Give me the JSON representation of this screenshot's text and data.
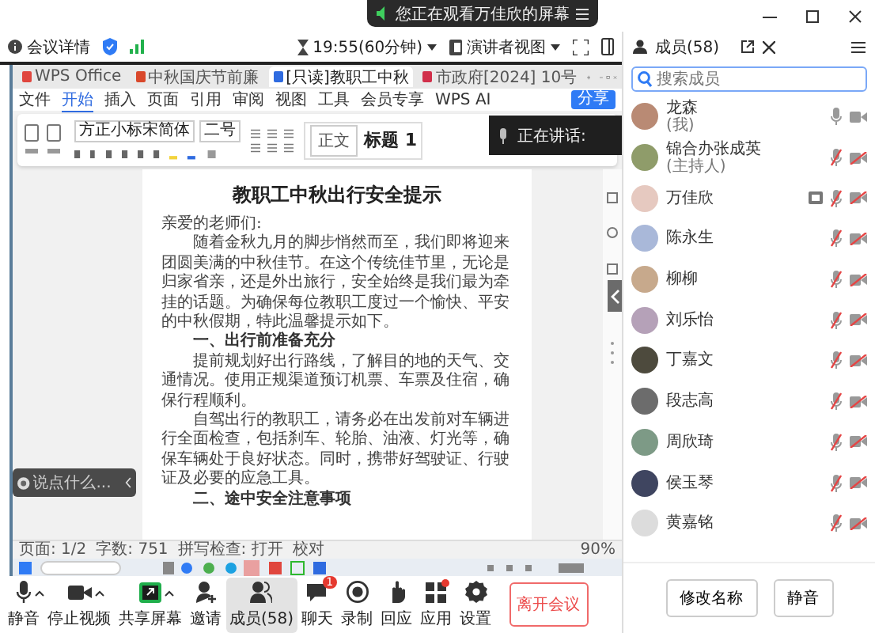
{
  "notice": {
    "text": "您正在观看万佳欣的屏幕"
  },
  "header": {
    "details": "会议详情",
    "duration": "19:55(60分钟)",
    "view": "演讲者视图"
  },
  "shared_screen": {
    "tabs": [
      {
        "label": "WPS Office",
        "kind": "home",
        "selected": false
      },
      {
        "label": "中秋国庆节前廉",
        "kind": "ppt",
        "selected": false
      },
      {
        "label": "[只读]教职工中秋",
        "kind": "doc",
        "selected": true
      },
      {
        "label": "市政府[2024] 10号",
        "kind": "pdf",
        "selected": false
      }
    ],
    "menu": [
      {
        "label": "文件",
        "selected": false
      },
      {
        "label": "开始",
        "selected": true
      },
      {
        "label": "插入",
        "selected": false
      },
      {
        "label": "页面",
        "selected": false
      },
      {
        "label": "引用",
        "selected": false
      },
      {
        "label": "审阅",
        "selected": false
      },
      {
        "label": "视图",
        "selected": false
      },
      {
        "label": "工具",
        "selected": false
      },
      {
        "label": "会员专享",
        "selected": false
      },
      {
        "label": "WPS AI",
        "selected": false
      }
    ],
    "share_button": "分享",
    "font": "方正小标宋简体",
    "font_size": "二号",
    "styles": [
      "正文",
      "标题 1"
    ],
    "document": {
      "title": "教职工中秋出行安全提示",
      "greeting": "亲爱的老师们:",
      "paragraphs": [
        {
          "kind": "body",
          "text": "随着金秋九月的脚步悄然而至，我们即将迎来团圆美满的中秋佳节。在这个传统佳节里，无论是归家省亲，还是外出旅行，安全始终是我们最为牵挂的话题。为确保每位教职工度过一个愉快、平安的中秋假期，特此温馨提示如下。"
        },
        {
          "kind": "heading",
          "text": "一、出行前准备充分"
        },
        {
          "kind": "body",
          "text": "提前规划好出行路线，了解目的地的天气、交通情况。使用正规渠道预订机票、车票及住宿，确保行程顺利。"
        },
        {
          "kind": "body",
          "text": "自驾出行的教职工，请务必在出发前对车辆进行全面检查，包括刹车、轮胎、油液、灯光等，确保车辆处于良好状态。同时，携带好驾驶证、行驶证及必要的应急工具。"
        },
        {
          "kind": "heading",
          "text": "二、途中安全注意事项"
        }
      ]
    },
    "status_bar": [
      "页面: 1/2",
      "字数: 751",
      "拼写检查: 打开",
      "校对"
    ],
    "zoom": "90%"
  },
  "speaking": {
    "text": "正在讲话:"
  },
  "chat_input": {
    "placeholder": "说点什么..."
  },
  "members_panel": {
    "title": "成员(58)",
    "search": {
      "placeholder": "搜索成员"
    },
    "members": [
      {
        "name": "龙森",
        "role": "(我)",
        "mic_on": true,
        "video_on": true,
        "sharing": false
      },
      {
        "name": "锦合办张成英",
        "role": "(主持人)",
        "mic_on": false,
        "video_on": false,
        "sharing": false
      },
      {
        "name": "万佳欣",
        "mic_on": false,
        "video_on": false,
        "sharing": true
      },
      {
        "name": "陈永生",
        "mic_on": false,
        "video_on": false,
        "sharing": false
      },
      {
        "name": "柳柳",
        "mic_on": false,
        "video_on": false,
        "sharing": false
      },
      {
        "name": "刘乐怡",
        "mic_on": false,
        "video_on": false,
        "sharing": false
      },
      {
        "name": "丁嘉文",
        "mic_on": false,
        "video_on": false,
        "sharing": false
      },
      {
        "name": "段志高",
        "mic_on": false,
        "video_on": false,
        "sharing": false
      },
      {
        "name": "周欣琦",
        "mic_on": false,
        "video_on": false,
        "sharing": false
      },
      {
        "name": "侯玉琴",
        "mic_on": false,
        "video_on": false,
        "sharing": false
      },
      {
        "name": "黄嘉铭",
        "mic_on": false,
        "video_on": false,
        "sharing": false
      }
    ],
    "buttons": [
      "修改名称",
      "静音"
    ]
  },
  "toolbar": {
    "items": [
      {
        "label": "静音",
        "caret": true,
        "selected": false,
        "dot": false
      },
      {
        "label": "停止视频",
        "caret": true,
        "selected": false,
        "dot": false
      },
      {
        "label": "共享屏幕",
        "caret": true,
        "selected": false,
        "dot": false
      },
      {
        "label": "邀请",
        "caret": false,
        "selected": false,
        "dot": false
      },
      {
        "label": "成员(58)",
        "caret": false,
        "selected": true,
        "dot": false
      },
      {
        "label": "聊天",
        "caret": false,
        "selected": false,
        "badge": "1",
        "dot": false
      },
      {
        "label": "录制",
        "caret": false,
        "selected": false,
        "dot": false
      },
      {
        "label": "回应",
        "caret": false,
        "selected": false,
        "dot": false
      },
      {
        "label": "应用",
        "caret": false,
        "selected": false,
        "dot": true
      },
      {
        "label": "设置",
        "caret": false,
        "selected": false,
        "dot": false
      }
    ],
    "leave": "离开会议"
  }
}
